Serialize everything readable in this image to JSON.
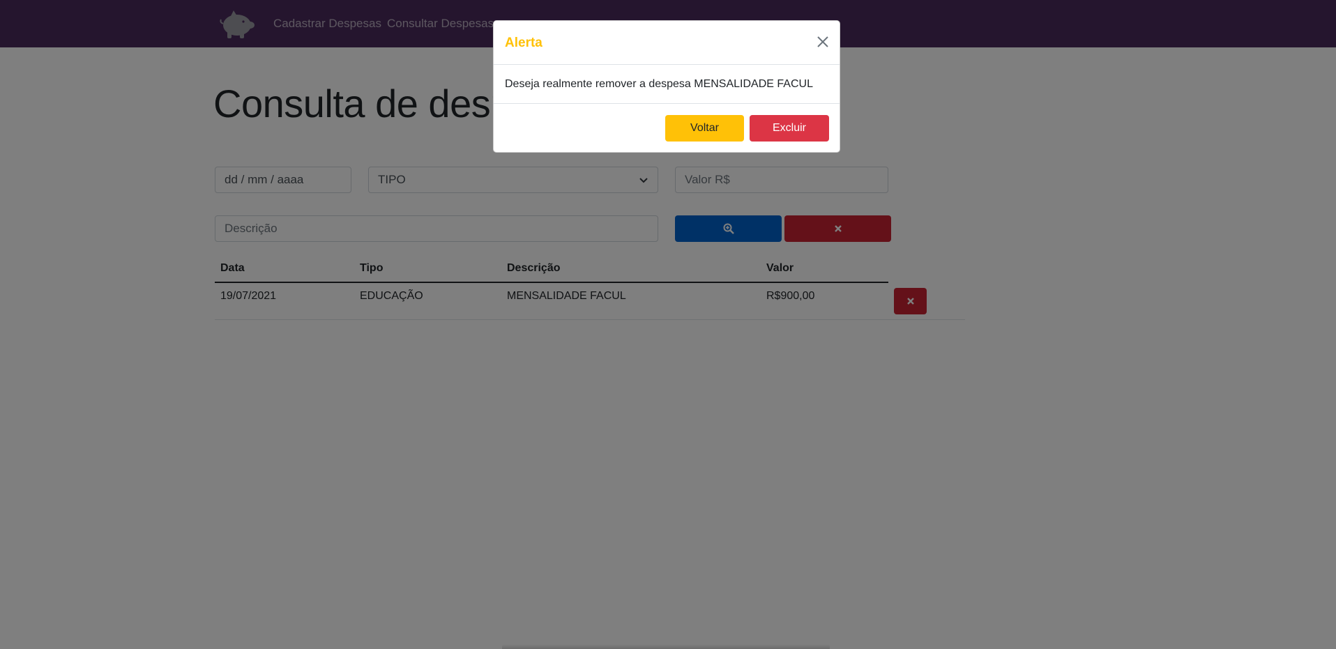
{
  "navbar": {
    "brand_icon": "piggy-bank-icon",
    "links": [
      "Cadastrar Despesas",
      "Consultar Despesas"
    ],
    "background": "#4a2a5c"
  },
  "page": {
    "title": "Consulta de despesas"
  },
  "filters": {
    "date_placeholder": "dd / mm / aaaa",
    "tipo_selected": "TIPO",
    "valor_placeholder": "Valor R$",
    "descricao_placeholder": "Descrição",
    "search_icon": "search-plus-icon",
    "clear_icon": "close-icon"
  },
  "table": {
    "headers": [
      "Data",
      "Tipo",
      "Descrição",
      "Valor"
    ],
    "rows": [
      {
        "data": "19/07/2021",
        "tipo": "EDUCAÇÃO",
        "descricao": "MENSALIDADE FACUL",
        "valor": "R$900,00"
      }
    ]
  },
  "modal": {
    "title": "Alerta",
    "message": "Deseja realmente remover a despesa MENSALIDADE FACUL",
    "cancel_label": "Voltar",
    "confirm_label": "Excluir",
    "title_color": "#ffc107",
    "confirm_color": "#dc3545"
  }
}
